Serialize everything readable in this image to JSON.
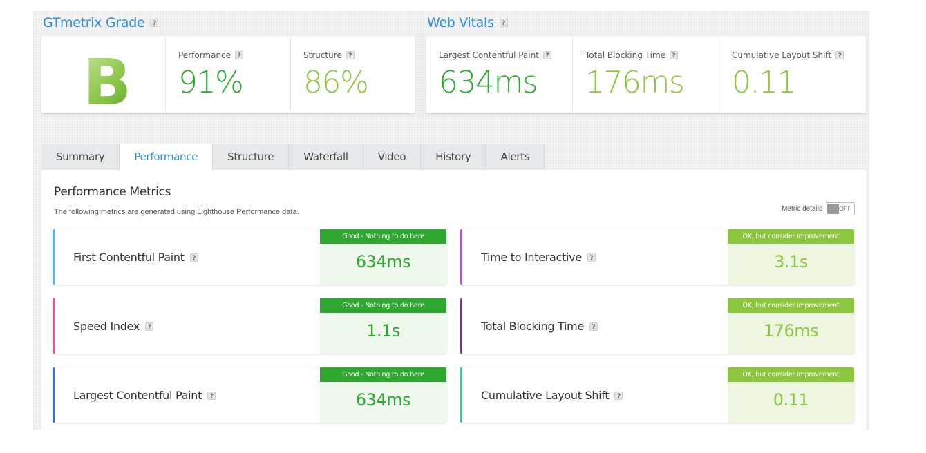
{
  "grade_section": {
    "title": "GTmetrix Grade",
    "grade": "B",
    "performance_label": "Performance",
    "performance_value": "91%",
    "structure_label": "Structure",
    "structure_value": "86%"
  },
  "vitals_section": {
    "title": "Web Vitals",
    "lcp_label": "Largest Contentful Paint",
    "lcp_value": "634ms",
    "tbt_label": "Total Blocking Time",
    "tbt_value": "176ms",
    "cls_label": "Cumulative Layout Shift",
    "cls_value": "0.11"
  },
  "help_glyph": "?",
  "tabs": [
    "Summary",
    "Performance",
    "Structure",
    "Waterfall",
    "Video",
    "History",
    "Alerts"
  ],
  "active_tab": "Performance",
  "metrics_panel": {
    "title": "Performance Metrics",
    "subtitle": "The following metrics are generated using Lighthouse Performance data.",
    "metric_details_label": "Metric details",
    "toggle_state": "OFF"
  },
  "metrics": [
    {
      "name": "First Contentful Paint",
      "value": "634ms",
      "status": "Good - Nothing to do here",
      "accent": "#4ab8e0"
    },
    {
      "name": "Time to Interactive",
      "value": "3.1s",
      "status": "OK, but consider improvement",
      "accent": "#a45fc6"
    },
    {
      "name": "Speed Index",
      "value": "1.1s",
      "status": "Good - Nothing to do here",
      "accent": "#e0559b"
    },
    {
      "name": "Total Blocking Time",
      "value": "176ms",
      "status": "OK, but consider improvement",
      "accent": "#6b3f7c"
    },
    {
      "name": "Largest Contentful Paint",
      "value": "634ms",
      "status": "Good - Nothing to do here",
      "accent": "#3f6fc6"
    },
    {
      "name": "Cumulative Layout Shift",
      "value": "0.11",
      "status": "OK, but consider improvement",
      "accent": "#3fbf9a"
    }
  ],
  "colors": {
    "good_green": "#2fa832",
    "good_bg": "#eef8ec",
    "ok_green": "#8cc63f",
    "ok_bg": "#eef6e2",
    "perf_value": "#2fa832",
    "structure_value": "#8cc63f",
    "lcp_value": "#2fa832",
    "tbt_value": "#8cc63f",
    "cls_value": "#8cc63f",
    "link_blue": "#2f8fd0"
  }
}
